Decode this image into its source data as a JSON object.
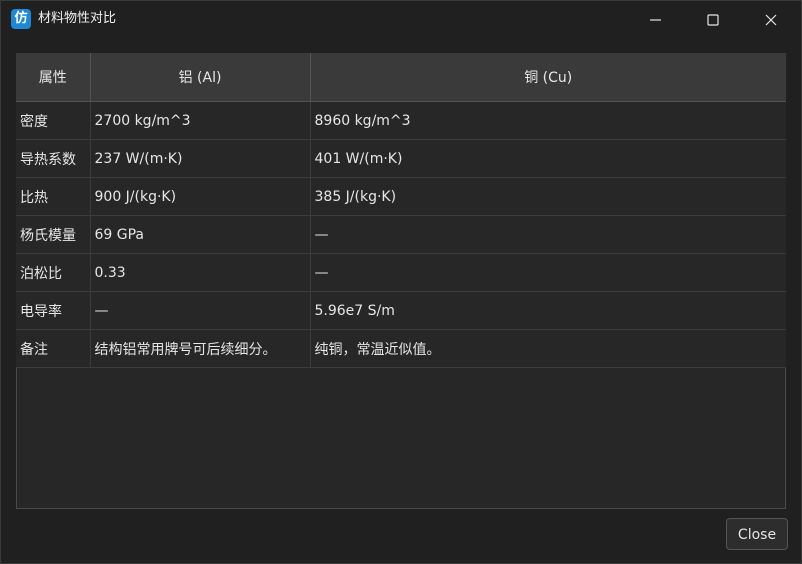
{
  "window": {
    "title": "材料物性对比",
    "icon_glyph": "仿",
    "icon_color": "#1e88d2"
  },
  "controls": {
    "minimize_icon": "minimize-icon",
    "maximize_icon": "maximize-icon",
    "close_icon": "close-icon"
  },
  "table": {
    "headers": [
      "属性",
      "铝 (Al)",
      "铜 (Cu)"
    ],
    "rows": [
      [
        "密度",
        "2700 kg/m^3",
        "8960 kg/m^3"
      ],
      [
        "导热系数",
        "237 W/(m·K)",
        "401 W/(m·K)"
      ],
      [
        "比热",
        "900 J/(kg·K)",
        "385 J/(kg·K)"
      ],
      [
        "杨氏模量",
        "69 GPa",
        "—"
      ],
      [
        "泊松比",
        "0.33",
        "—"
      ],
      [
        "电导率",
        "—",
        "5.96e7 S/m"
      ],
      [
        "备注",
        "结构铝常用牌号可后续细分。",
        "纯铜，常温近似值。"
      ]
    ]
  },
  "footer": {
    "close_label": "Close"
  }
}
